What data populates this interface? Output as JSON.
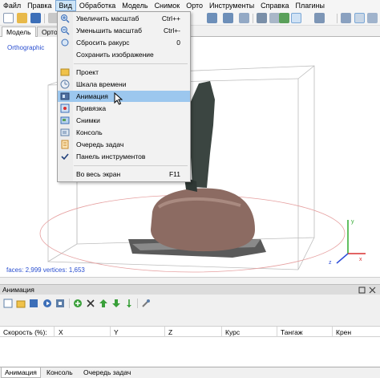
{
  "menubar": {
    "items": [
      "Файл",
      "Правка",
      "Вид",
      "Обработка",
      "Модель",
      "Снимок",
      "Орто",
      "Инструменты",
      "Справка",
      "Плагины"
    ]
  },
  "tabs": [
    "Модель",
    "Орто"
  ],
  "viewport": {
    "projection_label": "Orthographic",
    "stats_label": "faces: 2,999 vertices: 1,653"
  },
  "view_menu": {
    "items": [
      {
        "label": "Увеличить масштаб",
        "shortcut": "Ctrl++",
        "icon": "zoom-in-icon"
      },
      {
        "label": "Уменьшить масштаб",
        "shortcut": "Ctrl+-",
        "icon": "zoom-out-icon"
      },
      {
        "label": "Сбросить ракурс",
        "shortcut": "0",
        "icon": "reset-view-icon"
      },
      {
        "label": "Сохранить изображение",
        "shortcut": "",
        "icon": ""
      },
      {
        "label": "Проект",
        "shortcut": "",
        "icon": "project-icon"
      },
      {
        "label": "Шкала времени",
        "shortcut": "",
        "icon": "timeline-icon"
      },
      {
        "label": "Анимация",
        "shortcut": "",
        "icon": "animation-icon"
      },
      {
        "label": "Привязка",
        "shortcut": "",
        "icon": "reference-icon"
      },
      {
        "label": "Снимки",
        "shortcut": "",
        "icon": "photos-icon"
      },
      {
        "label": "Консоль",
        "shortcut": "",
        "icon": "console-icon"
      },
      {
        "label": "Очередь задач",
        "shortcut": "",
        "icon": "jobs-icon"
      },
      {
        "label": "Панель инструментов",
        "shortcut": "",
        "icon": "checkmark-icon"
      },
      {
        "label": "Во весь экран",
        "shortcut": "F11",
        "icon": ""
      }
    ],
    "highlighted_index": 6
  },
  "animation_panel": {
    "title": "Анимация",
    "columns": [
      "Скорость (%):",
      "X",
      "Y",
      "Z",
      "Курс",
      "Тангаж",
      "Крен"
    ]
  },
  "bottom_tabs": [
    "Анимация",
    "Консоль",
    "Очередь задач"
  ],
  "colors": {
    "accent": "#2a4fd0",
    "highlight": "#9cc7ee"
  }
}
